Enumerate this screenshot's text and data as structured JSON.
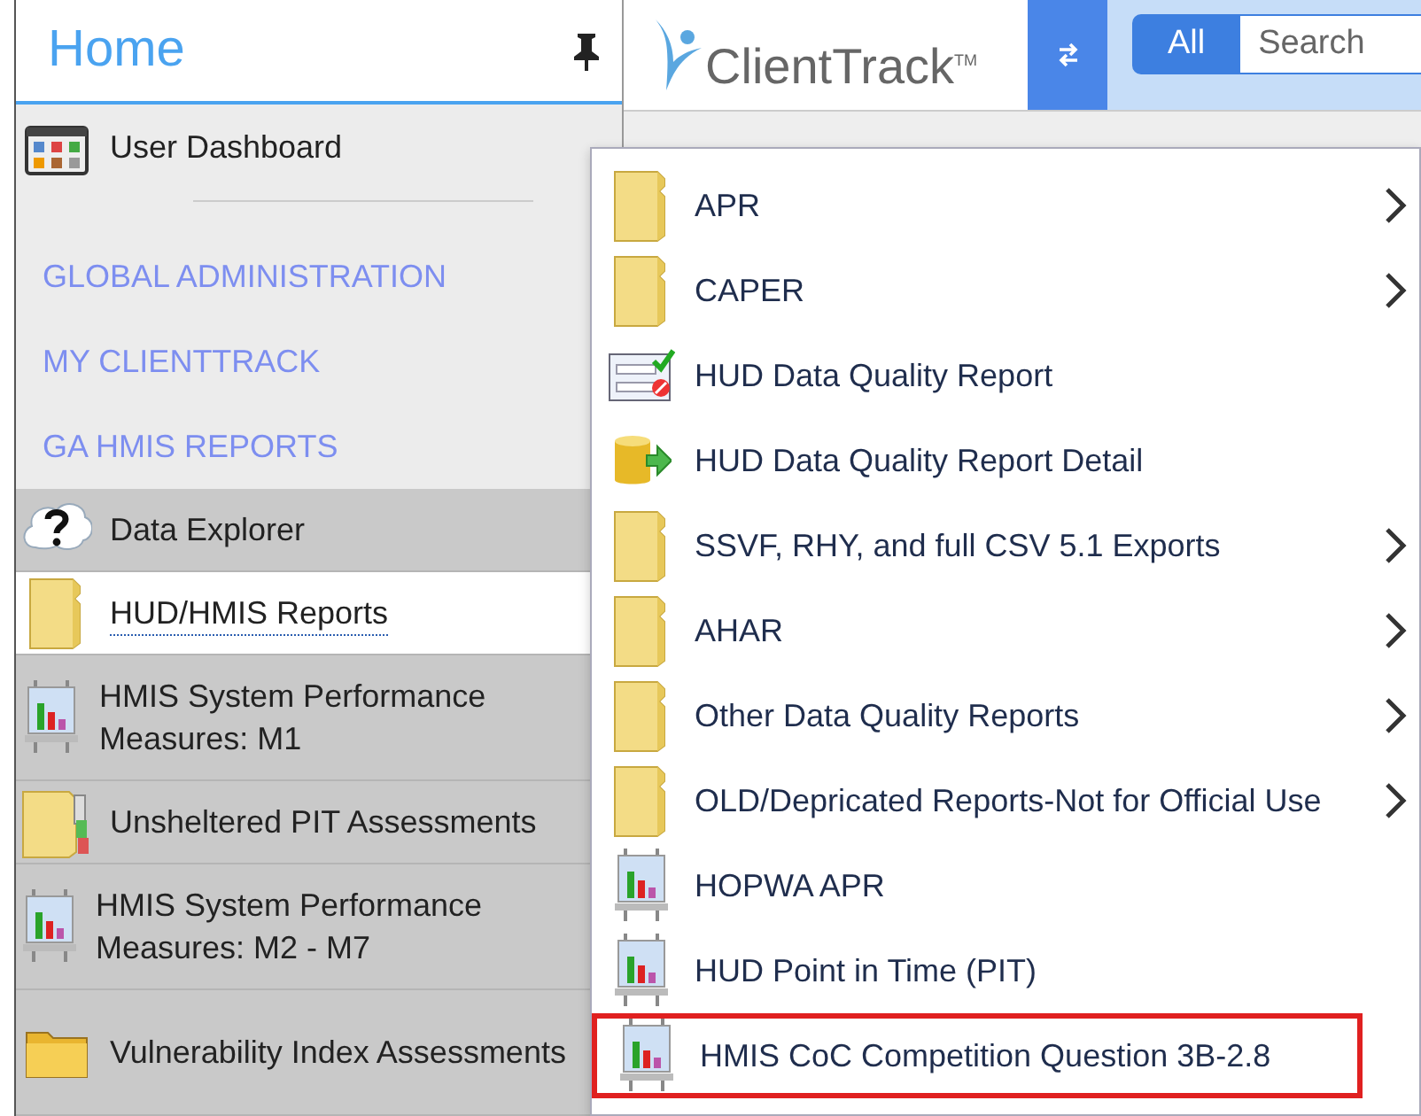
{
  "sidebar": {
    "title": "Home",
    "items": [
      {
        "kind": "dashboard",
        "label": "User Dashboard",
        "selected": false
      },
      {
        "kind": "link",
        "label": "GLOBAL ADMINISTRATION",
        "selected": false
      },
      {
        "kind": "link",
        "label": "MY CLIENTTRACK",
        "selected": false
      },
      {
        "kind": "link",
        "label": "GA HMIS REPORTS",
        "selected": false
      },
      {
        "kind": "help",
        "label": "Data Explorer",
        "selected": false
      },
      {
        "kind": "folder",
        "label": "HUD/HMIS Reports",
        "selected": true
      },
      {
        "kind": "chart",
        "label": "HMIS System Performance Measures: M1",
        "selected": false
      },
      {
        "kind": "folder-docs",
        "label": "Unsheltered PIT Assessments",
        "selected": false
      },
      {
        "kind": "chart",
        "label": "HMIS System Performance Measures: M2 - M7",
        "selected": false
      },
      {
        "kind": "small-folder",
        "label": "Vulnerability Index Assessments",
        "selected": false
      }
    ]
  },
  "header": {
    "logo": "ClientTrack",
    "trademark": "TM",
    "search_scope": "All",
    "search": {
      "placeholder": "Search"
    }
  },
  "menu": {
    "items": [
      {
        "kind": "folder",
        "label": "APR",
        "submenu": true,
        "highlighted": false
      },
      {
        "kind": "folder",
        "label": "CAPER",
        "submenu": true,
        "highlighted": false
      },
      {
        "kind": "checklist",
        "label": "HUD Data Quality Report",
        "submenu": false,
        "highlighted": false
      },
      {
        "kind": "database",
        "label": "HUD Data Quality Report Detail",
        "submenu": false,
        "highlighted": false
      },
      {
        "kind": "folder",
        "label": "SSVF, RHY, and full CSV 5.1 Exports",
        "submenu": true,
        "highlighted": false
      },
      {
        "kind": "folder",
        "label": "AHAR",
        "submenu": true,
        "highlighted": false
      },
      {
        "kind": "folder",
        "label": "Other Data Quality Reports",
        "submenu": true,
        "highlighted": false
      },
      {
        "kind": "folder",
        "label": "OLD/Depricated Reports-Not for Official Use",
        "submenu": true,
        "highlighted": false
      },
      {
        "kind": "chart",
        "label": "HOPWA APR",
        "submenu": false,
        "highlighted": false
      },
      {
        "kind": "chart",
        "label": "HUD Point in Time (PIT)",
        "submenu": false,
        "highlighted": false
      },
      {
        "kind": "chart",
        "label": "HMIS CoC Competition Question 3B-2.8",
        "submenu": false,
        "highlighted": true
      }
    ]
  }
}
